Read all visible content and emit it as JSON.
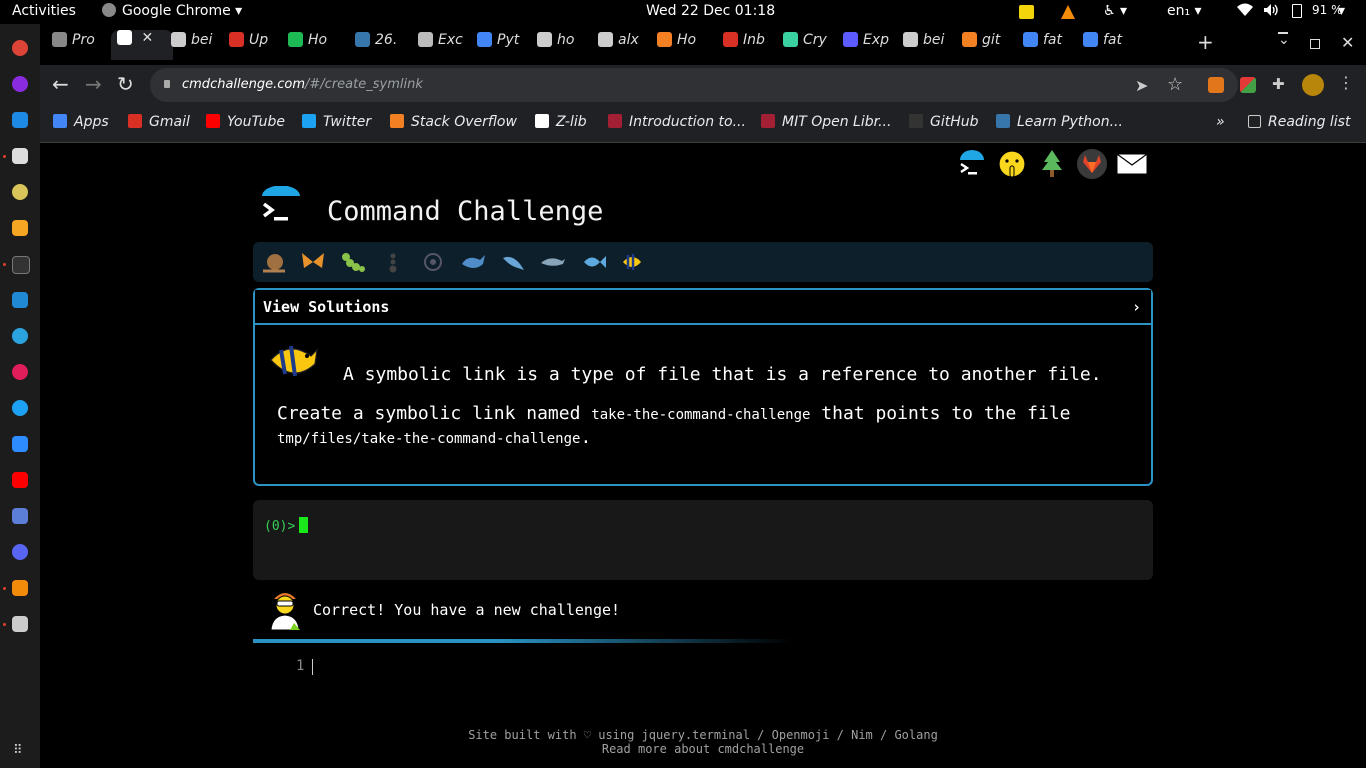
{
  "system_bar": {
    "activities": "Activities",
    "app_name": "Google Chrome",
    "clock": "Wed 22 Dec 01:18",
    "language": "en₁",
    "battery": "91 %"
  },
  "tabs": [
    {
      "label": "Pro",
      "favicon": "ubuntu-icon",
      "color": "#888888"
    },
    {
      "label": "",
      "favicon": "terminal-icon",
      "color": "#ffffff",
      "active": true
    },
    {
      "label": "bei",
      "favicon": "github-icon",
      "color": "#cccccc"
    },
    {
      "label": "Up",
      "favicon": "gmail-icon",
      "color": "#d93025"
    },
    {
      "label": "Ho",
      "favicon": "link-icon",
      "color": "#1db954"
    },
    {
      "label": "26.",
      "favicon": "python-icon",
      "color": "#3776ab"
    },
    {
      "label": "Exc",
      "favicon": "doc-icon",
      "color": "#bbbbbb"
    },
    {
      "label": "Pyt",
      "favicon": "google-icon",
      "color": "#4285f4"
    },
    {
      "label": "ho",
      "favicon": "github-icon",
      "color": "#cccccc"
    },
    {
      "label": "alx",
      "favicon": "github-icon",
      "color": "#cccccc"
    },
    {
      "label": "Ho",
      "favicon": "stackoverflow-icon",
      "color": "#f48024"
    },
    {
      "label": "Inb",
      "favicon": "gmail-icon",
      "color": "#d93025"
    },
    {
      "label": "Cry",
      "favicon": "mountain-icon",
      "color": "#3ad0a0"
    },
    {
      "label": "Exp",
      "favicon": "flask-icon",
      "color": "#5b5bff"
    },
    {
      "label": "bei",
      "favicon": "github-icon",
      "color": "#cccccc"
    },
    {
      "label": "git",
      "favicon": "stackoverflow-icon",
      "color": "#f48024"
    },
    {
      "label": "fat",
      "favicon": "google-icon",
      "color": "#4285f4"
    },
    {
      "label": "fat",
      "favicon": "google-icon",
      "color": "#4285f4"
    }
  ],
  "address_bar": {
    "host": "cmdchallenge.com",
    "path": "/#/create_symlink"
  },
  "bookmarks": [
    {
      "label": "Apps",
      "favicon": "apps-grid-icon",
      "color": "#4285f4"
    },
    {
      "label": "Gmail",
      "favicon": "gmail-icon",
      "color": "#d93025"
    },
    {
      "label": "YouTube",
      "favicon": "youtube-icon",
      "color": "#ff0000"
    },
    {
      "label": "Twitter",
      "favicon": "twitter-icon",
      "color": "#1da1f2"
    },
    {
      "label": "Stack Overflow",
      "favicon": "stackoverflow-icon",
      "color": "#f48024"
    },
    {
      "label": "Z-lib",
      "favicon": "zlib-icon",
      "color": "#ffffff"
    },
    {
      "label": "Introduction to...",
      "favicon": "mit-ocw-icon",
      "color": "#a31f34"
    },
    {
      "label": "MIT Open Libr...",
      "favicon": "mit-icon",
      "color": "#a31f34"
    },
    {
      "label": "GitHub",
      "favicon": "github-icon",
      "color": "#333333"
    },
    {
      "label": "Learn Python...",
      "favicon": "python-icon",
      "color": "#3776ab"
    }
  ],
  "reading_list": "Reading list",
  "page": {
    "title": "Command Challenge",
    "view_solutions": "View Solutions",
    "intro": "A symbolic link is a type of file that is a reference to another file.",
    "task_prefix": "Create a symbolic link named ",
    "task_link_name": "take-the-command-challenge",
    "task_middle": " that points to the file",
    "task_path": "tmp/files/take-the-command-challenge",
    "task_suffix": ".",
    "prompt": "(0)>",
    "status_message": "Correct! You have a new challenge!",
    "editor_line_number": "1",
    "footer_line1": "Site built with ♡ using jquery.terminal / Openmoji / Nim / Golang",
    "footer_line2": "Read more about cmdchallenge"
  },
  "colors": {
    "accent": "#2b93c4",
    "prompt": "#34d058",
    "cursor": "#1be81b",
    "level_bar": "#0c1f2a"
  }
}
